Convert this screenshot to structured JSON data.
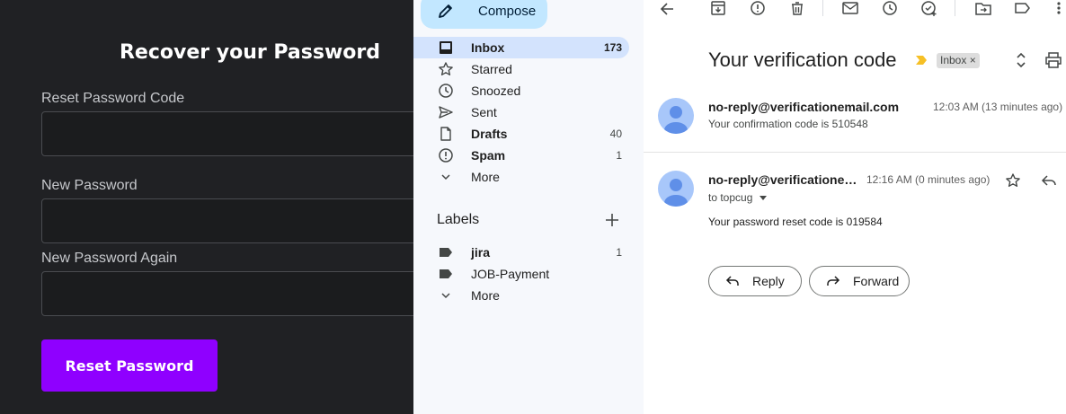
{
  "recover_form": {
    "title": "Recover your Password",
    "code_label": "Reset Password Code",
    "new_password_label": "New Password",
    "new_password_again_label": "New Password Again",
    "code_value": "",
    "new_password_value": "",
    "new_password_again_value": "",
    "submit_label": "Reset Password",
    "accent_color": "#8f00ff"
  },
  "gmail_sidebar": {
    "compose_label": "Compose",
    "items": [
      {
        "label": "Inbox",
        "count": "173",
        "icon": "inbox-icon"
      },
      {
        "label": "Starred",
        "count": "",
        "icon": "star-icon"
      },
      {
        "label": "Snoozed",
        "count": "",
        "icon": "clock-icon"
      },
      {
        "label": "Sent",
        "count": "",
        "icon": "send-icon"
      },
      {
        "label": "Drafts",
        "count": "40",
        "icon": "draft-icon"
      },
      {
        "label": "Spam",
        "count": "1",
        "icon": "spam-icon"
      },
      {
        "label": "More",
        "count": "",
        "icon": "chevron-down-icon"
      }
    ],
    "labels_heading": "Labels",
    "labels": [
      {
        "label": "jira",
        "count": "1",
        "icon": "label-icon"
      },
      {
        "label": "JOB-Payment",
        "count": "",
        "icon": "label-icon"
      },
      {
        "label": "More",
        "count": "",
        "icon": "chevron-down-icon"
      }
    ],
    "active_color": "#d3e3fd"
  },
  "reading_pane": {
    "subject": "Your verification code",
    "label_tag": "Inbox",
    "label_tag_close": "×",
    "messages": [
      {
        "sender": "no-reply@verificationemail.com",
        "time": "12:03 AM (13 minutes ago)",
        "snippet": "Your confirmation code is 510548"
      },
      {
        "sender": "no-reply@verificatione…",
        "time": "12:16 AM (0 minutes ago)",
        "to": "to topcug",
        "body": "Your password reset code is 019584"
      }
    ],
    "reply_label": "Reply",
    "forward_label": "Forward"
  }
}
